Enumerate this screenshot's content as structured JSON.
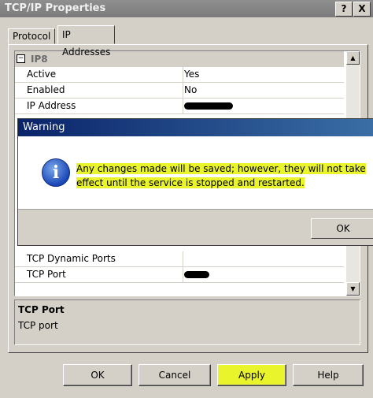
{
  "window": {
    "title": "TCP/IP Properties",
    "help_glyph": "?",
    "close_glyph": "X"
  },
  "tabs": [
    {
      "label": "Protocol",
      "active": false
    },
    {
      "label": "IP Addresses",
      "active": true
    }
  ],
  "grid": {
    "group_label": "IP8",
    "expander_glyph": "−",
    "top_rows": [
      {
        "key": "Active",
        "value": "Yes"
      },
      {
        "key": "Enabled",
        "value": "No"
      },
      {
        "key": "IP Address",
        "value": ""
      }
    ],
    "bottom_rows": [
      {
        "key": "TCP Dynamic Ports",
        "value": ""
      },
      {
        "key": "TCP Port",
        "value": ""
      }
    ]
  },
  "description": {
    "title": "TCP Port",
    "text": "TCP port"
  },
  "buttons": {
    "ok": "OK",
    "cancel": "Cancel",
    "apply": "Apply",
    "help": "Help"
  },
  "warning_dialog": {
    "title": "Warning",
    "icon": "info-icon",
    "message": "Any changes made will be saved; however, they will not take effect until the service is stopped and restarted.",
    "ok": "OK"
  },
  "colors": {
    "highlight": "#e9f42a",
    "dialog_title": "#0a246a"
  }
}
